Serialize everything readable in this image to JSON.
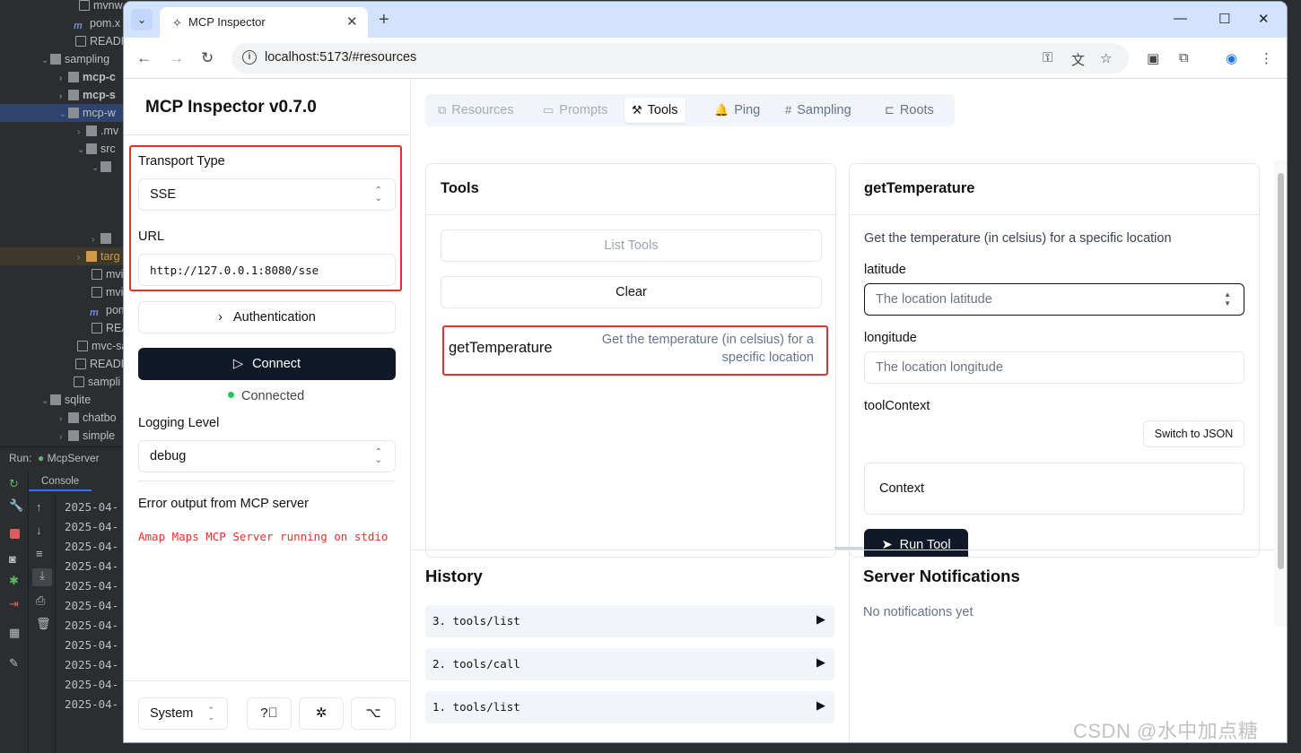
{
  "ide": {
    "tree": [
      "mvnw.",
      "pom.x",
      "READN",
      "sampling",
      "mcp-c",
      "mcp-s",
      "mcp-w",
      ".mv",
      "src",
      "",
      "",
      "targ",
      "mvi",
      "mvi",
      "pom",
      "REA",
      "mvc-sa",
      "READN",
      "sampli",
      "sqlite",
      "chatbo",
      "simple"
    ],
    "run_label": "Run:",
    "run_config": "McpServer",
    "console_tab": "Console",
    "log_lines": [
      "2025-04-",
      "2025-04-",
      "2025-04-",
      "2025-04-",
      "2025-04-",
      "2025-04-",
      "2025-04-",
      "2025-04-",
      "2025-04-",
      "2025-04-",
      "2025-04-"
    ]
  },
  "browser": {
    "tab_title": "MCP Inspector",
    "url": "localhost:5173/#resources"
  },
  "sidebar": {
    "title": "MCP Inspector v0.7.0",
    "transport_label": "Transport Type",
    "transport_value": "SSE",
    "url_label": "URL",
    "url_value": "http://127.0.0.1:8080/sse",
    "auth_label": "Authentication",
    "connect_label": "Connect",
    "status": "Connected",
    "logging_label": "Logging Level",
    "logging_value": "debug",
    "error_title": "Error output from MCP server",
    "error_text": "Amap Maps MCP Server running on stdio",
    "theme_value": "System"
  },
  "tabs": [
    {
      "label": "Resources",
      "icon": "resources-icon"
    },
    {
      "label": "Prompts",
      "icon": "prompts-icon"
    },
    {
      "label": "Tools",
      "icon": "hammer-icon"
    },
    {
      "label": "Ping",
      "icon": "bell-icon"
    },
    {
      "label": "Sampling",
      "icon": "hash-icon"
    },
    {
      "label": "Roots",
      "icon": "roots-icon"
    }
  ],
  "tools_card": {
    "title": "Tools",
    "list_tools": "List Tools",
    "clear": "Clear",
    "tool_name": "getTemperature",
    "tool_desc": "Get the temperature (in celsius) for a specific location"
  },
  "detail_card": {
    "title": "getTemperature",
    "description": "Get the temperature (in celsius) for a specific location",
    "latitude_label": "latitude",
    "latitude_placeholder": "The location latitude",
    "longitude_label": "longitude",
    "longitude_placeholder": "The location longitude",
    "context_label": "toolContext",
    "switch_json": "Switch to JSON",
    "context_value": "Context",
    "run_tool": "Run Tool"
  },
  "history": {
    "title": "History",
    "items": [
      "3. tools/list",
      "2. tools/call",
      "1. tools/list"
    ]
  },
  "notifications": {
    "title": "Server Notifications",
    "empty": "No notifications yet"
  },
  "watermark": "CSDN @水中加点糖",
  "colors": {
    "highlight": "#e5302b",
    "primary": "#111827",
    "status_green": "#22c55e"
  }
}
